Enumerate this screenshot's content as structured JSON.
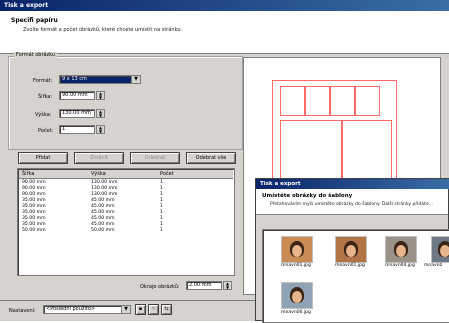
{
  "window": {
    "title": "Tisk a export"
  },
  "header": {
    "title": "Specifi papíru",
    "subtitle": "Zvolte formát a počet obrázků, které chcete umístit na stránku."
  },
  "format_group": {
    "legend": "Formát obrázku",
    "format_label": "Formát:",
    "format_value": "9 x 13 cm",
    "width_label": "Šířka:",
    "width_value": "90.00 mm",
    "height_label": "Výška:",
    "height_value": "130.00 mm",
    "count_label": "Počet:",
    "count_value": "1"
  },
  "buttons": {
    "add": "Přidat",
    "change": "Změnit",
    "delete": "Odebrat",
    "delete_all": "Odebrat vše"
  },
  "list": {
    "columns": [
      "Šířka",
      "Výška",
      "Počet"
    ],
    "rows": [
      [
        "90.00 mm",
        "130.00 mm",
        "1"
      ],
      [
        "90.00 mm",
        "130.00 mm",
        "1"
      ],
      [
        "90.00 mm",
        "130.00 mm",
        "1"
      ],
      [
        "35.00 mm",
        "45.00 mm",
        "1"
      ],
      [
        "35.00 mm",
        "45.00 mm",
        "1"
      ],
      [
        "35.00 mm",
        "45.00 mm",
        "1"
      ],
      [
        "35.00 mm",
        "45.00 mm",
        "1"
      ],
      [
        "35.00 mm",
        "45.00 mm",
        "1"
      ],
      [
        "50.00 mm",
        "50.00 mm",
        "1"
      ]
    ]
  },
  "spacing": {
    "label": "Okraje obrázků:",
    "value": "2.00 mm"
  },
  "footer": {
    "settings_label": "Nastavení:",
    "settings_value": "<Poslední použito>"
  },
  "dialog2": {
    "title": "Tisk a export",
    "header_title": "Umístěte obrázky do šablony",
    "header_sub": "Přetahováním myši umístěte obrázky do šablony. Další stránky přidáte…",
    "thumbs": [
      {
        "caption": "mnavn01.jpg"
      },
      {
        "caption": "mnavn01.jpg"
      },
      {
        "caption": "mnavn04.jpg"
      },
      {
        "caption": "mnavn0"
      },
      {
        "caption": "mnavn06.jpg"
      }
    ]
  },
  "colors": {
    "title_bar": "#0a246a",
    "preview_border": "#ff6b6b",
    "selection": "#0a246a"
  }
}
